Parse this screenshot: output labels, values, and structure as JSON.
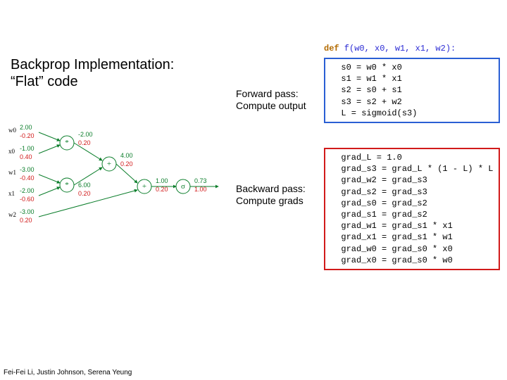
{
  "title": {
    "line1": "Backprop Implementation:",
    "line2": "“Flat” code"
  },
  "labels": {
    "forward_line1": "Forward pass:",
    "forward_line2": "Compute output",
    "backward_line1": "Backward pass:",
    "backward_line2": "Compute grads"
  },
  "signature": {
    "def": "def",
    "rest": " f(w0, x0, w1, x1, w2):"
  },
  "forward_code": [
    "  s0 = w0 * x0",
    "  s1 = w1 * x1",
    "  s2 = s0 + s1",
    "  s3 = s2 + w2",
    "  L = sigmoid(s3)"
  ],
  "backward_code": [
    "  grad_L = 1.0",
    "  grad_s3 = grad_L * (1 - L) * L",
    "  grad_w2 = grad_s3",
    "  grad_s2 = grad_s3",
    "  grad_s0 = grad_s2",
    "  grad_s1 = grad_s2",
    "  grad_w1 = grad_s1 * x1",
    "  grad_x1 = grad_s1 * w1",
    "  grad_w0 = grad_s0 * x0",
    "  grad_x0 = grad_s0 * w0"
  ],
  "graph": {
    "inputs": [
      {
        "name": "w0",
        "val": "2.00",
        "grad": "-0.20"
      },
      {
        "name": "x0",
        "val": "-1.00",
        "grad": "0.40"
      },
      {
        "name": "w1",
        "val": "-3.00",
        "grad": "-0.40"
      },
      {
        "name": "x1",
        "val": "-2.00",
        "grad": "-0.60"
      },
      {
        "name": "w2",
        "val": "-3.00",
        "grad": "0.20"
      }
    ],
    "edges": [
      {
        "top": "-2.00",
        "bot": "0.20"
      },
      {
        "top": "6.00",
        "bot": "0.20"
      },
      {
        "top": "4.00",
        "bot": "0.20"
      },
      {
        "top": "1.00",
        "bot": "0.20"
      },
      {
        "top": "0.73",
        "bot": "1.00"
      }
    ],
    "ops": [
      "*",
      "*",
      "+",
      "+",
      "σ"
    ]
  },
  "footer": "Fei-Fei Li, Justin Johnson, Serena Yeung"
}
